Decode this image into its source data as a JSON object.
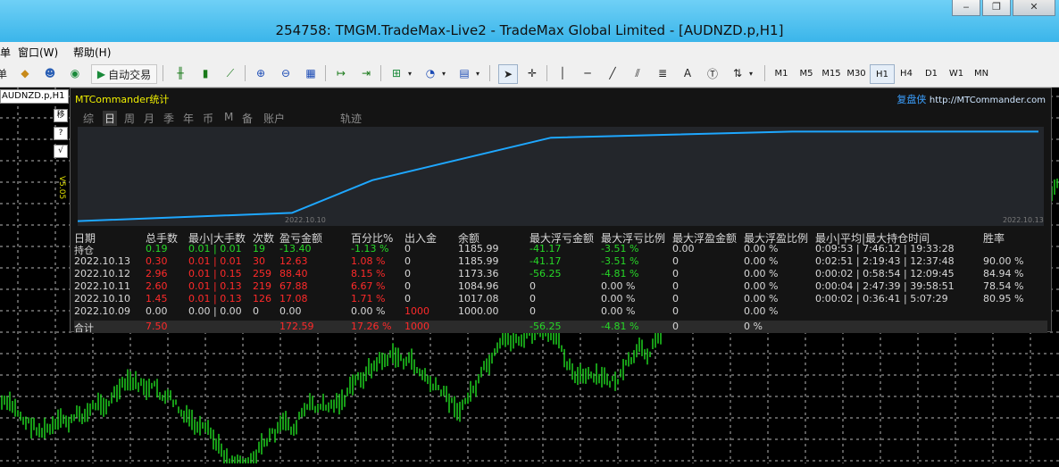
{
  "window": {
    "title": "254758: TMGM.TradeMax-Live2 - TradeMax Global Limited - [AUDNZD.p,H1]",
    "buttons": [
      "0",
      "1",
      "r"
    ]
  },
  "menu": {
    "items": [
      "单",
      "窗口(W)",
      "帮助(H)"
    ]
  },
  "toolbar": {
    "autotrade_label": "自动交易",
    "timeframes": [
      "M1",
      "M5",
      "M15",
      "M30",
      "H1",
      "H4",
      "D1",
      "W1",
      "MN"
    ],
    "selected_timeframe": "H1"
  },
  "chart": {
    "tab_label": "AUDNZD.p,H1",
    "side_buttons": [
      "移",
      "?",
      "√"
    ],
    "side_label": "V5.05",
    "candle_color": "#1fcf1f",
    "grid_color": "#e8e8e8"
  },
  "mt": {
    "title": "MTCommander统计",
    "brand": "复盘侠",
    "url": "http://MTCommander.com",
    "tabs": [
      "综",
      "日",
      "周",
      "月",
      "季",
      "年",
      "币",
      "M",
      "备",
      "账户",
      "轨迹"
    ],
    "active_tab": "日",
    "chart_start_label": "2022.10.10",
    "chart_end_label": "2022.10.13",
    "line_color": "#1ea7ff",
    "columns": [
      "日期",
      "总手数",
      "最小|大手数",
      "次数",
      "盈亏金额",
      "百分比%",
      "出入金",
      "余额",
      "最大浮亏金额",
      "最大浮亏比例",
      "最大浮盈金额",
      "最大浮盈比例",
      "最小|平均|最大持仓时间",
      "胜率"
    ],
    "rows": [
      [
        "持仓",
        "0.19",
        "0.01 | 0.01",
        "19",
        "-13.40",
        "-1.13 %",
        "0",
        "1185.99",
        "-41.17",
        "-3.51 %",
        "0.00",
        "0.00 %",
        "0:09:53 | 7:46:12 | 19:33:28",
        ""
      ],
      [
        "2022.10.13",
        "0.30",
        "0.01 | 0.01",
        "30",
        "12.63",
        "1.08 %",
        "0",
        "1185.99",
        "-41.17",
        "-3.51 %",
        "0",
        "0.00 %",
        "0:02:51 | 2:19:43 | 12:37:48",
        "90.00 %"
      ],
      [
        "2022.10.12",
        "2.96",
        "0.01 | 0.15",
        "259",
        "88.40",
        "8.15 %",
        "0",
        "1173.36",
        "-56.25",
        "-4.81 %",
        "0",
        "0.00 %",
        "0:00:02 | 0:58:54 | 12:09:45",
        "84.94 %"
      ],
      [
        "2022.10.11",
        "2.60",
        "0.01 | 0.13",
        "219",
        "67.88",
        "6.67 %",
        "0",
        "1084.96",
        "0",
        "0.00 %",
        "0",
        "0.00 %",
        "0:00:04 | 2:47:39 | 39:58:51",
        "78.54 %"
      ],
      [
        "2022.10.10",
        "1.45",
        "0.01 | 0.13",
        "126",
        "17.08",
        "1.71 %",
        "0",
        "1017.08",
        "0",
        "0.00 %",
        "0",
        "0.00 %",
        "0:00:02 | 0:36:41 | 5:07:29",
        "80.95 %"
      ],
      [
        "2022.10.09",
        "0.00",
        "0.00 | 0.00",
        "0",
        "0.00",
        "0.00 %",
        "1000",
        "1000.00",
        "0",
        "0.00 %",
        "0",
        "0.00 %",
        "",
        ""
      ]
    ],
    "total": [
      "合计",
      "7.50",
      "",
      "",
      "172.59",
      "17.26 %",
      "1000",
      "",
      "-56.25",
      "-4.81 %",
      "0",
      "0 %",
      "",
      ""
    ]
  }
}
